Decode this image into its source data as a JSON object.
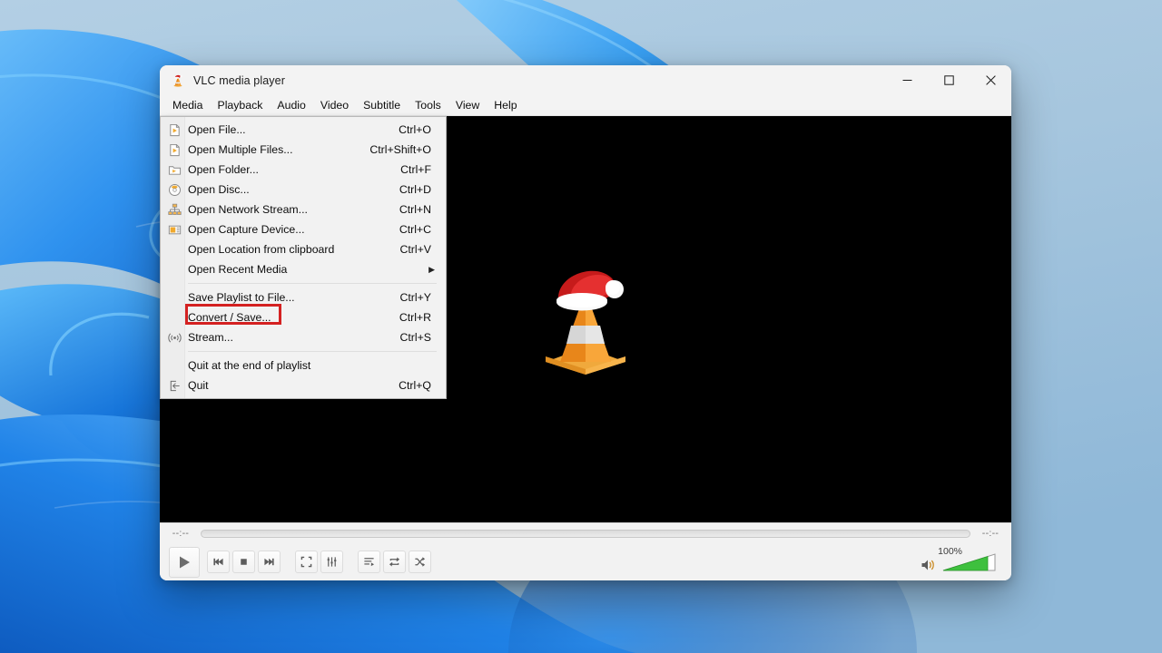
{
  "desktop": {
    "wallpaper_name": "windows-11-bloom-wallpaper",
    "background_color": "#a4c4dd",
    "ribbon_color_light": "#4aa8f0",
    "ribbon_color_mid": "#1f7fe0",
    "ribbon_color_dark": "#0b5fc4"
  },
  "window": {
    "title": "VLC media player",
    "icon": "vlc-cone-santa-icon",
    "caption": {
      "minimize": "minimize-icon",
      "maximize": "maximize-icon",
      "close": "close-icon"
    }
  },
  "menubar": {
    "items": [
      {
        "label": "Media"
      },
      {
        "label": "Playback"
      },
      {
        "label": "Audio"
      },
      {
        "label": "Video"
      },
      {
        "label": "Subtitle"
      },
      {
        "label": "Tools"
      },
      {
        "label": "View"
      },
      {
        "label": "Help"
      }
    ]
  },
  "media_menu": {
    "open": true,
    "highlight": {
      "target_label": "Convert / Save...",
      "color": "#d42121"
    },
    "groups": [
      {
        "items": [
          {
            "label": "Open File...",
            "shortcut": "Ctrl+O",
            "icon": "file-icon",
            "submenu": false
          },
          {
            "label": "Open Multiple Files...",
            "shortcut": "Ctrl+Shift+O",
            "icon": "file-icon",
            "submenu": false
          },
          {
            "label": "Open Folder...",
            "shortcut": "Ctrl+F",
            "icon": "folder-icon",
            "submenu": false
          },
          {
            "label": "Open Disc...",
            "shortcut": "Ctrl+D",
            "icon": "disc-icon",
            "submenu": false
          },
          {
            "label": "Open Network Stream...",
            "shortcut": "Ctrl+N",
            "icon": "network-icon",
            "submenu": false
          },
          {
            "label": "Open Capture Device...",
            "shortcut": "Ctrl+C",
            "icon": "capture-device-icon",
            "submenu": false
          },
          {
            "label": "Open Location from clipboard",
            "shortcut": "Ctrl+V",
            "icon": "",
            "submenu": false
          },
          {
            "label": "Open Recent Media",
            "shortcut": "",
            "icon": "",
            "submenu": true
          }
        ]
      },
      {
        "items": [
          {
            "label": "Save Playlist to File...",
            "shortcut": "Ctrl+Y",
            "icon": "",
            "submenu": false
          },
          {
            "label": "Convert / Save...",
            "shortcut": "Ctrl+R",
            "icon": "",
            "submenu": false
          },
          {
            "label": "Stream...",
            "shortcut": "Ctrl+S",
            "icon": "broadcast-icon",
            "submenu": false
          }
        ]
      },
      {
        "items": [
          {
            "label": "Quit at the end of playlist",
            "shortcut": "",
            "icon": "",
            "submenu": false
          },
          {
            "label": "Quit",
            "shortcut": "Ctrl+Q",
            "icon": "exit-icon",
            "submenu": false
          }
        ]
      }
    ]
  },
  "video": {
    "background_color": "#000000",
    "placeholder_icon": "vlc-cone-santa-logo"
  },
  "controls": {
    "time_elapsed": "--:--",
    "time_total": "--:--",
    "seek_position_percent": 0,
    "buttons": [
      {
        "name": "play-button",
        "icon": "play-icon"
      },
      {
        "name": "previous-button",
        "icon": "previous-track-icon"
      },
      {
        "name": "stop-button",
        "icon": "stop-icon"
      },
      {
        "name": "next-button",
        "icon": "next-track-icon"
      },
      {
        "name": "fullscreen-button",
        "icon": "fullscreen-icon"
      },
      {
        "name": "equalizer-button",
        "icon": "equalizer-icon"
      },
      {
        "name": "playlist-button",
        "icon": "playlist-icon"
      },
      {
        "name": "loop-button",
        "icon": "loop-icon"
      },
      {
        "name": "shuffle-button",
        "icon": "shuffle-icon"
      }
    ],
    "volume": {
      "label": "100%",
      "value": 100,
      "icon": "speaker-icon",
      "slider_color": "#3ec03e"
    }
  }
}
